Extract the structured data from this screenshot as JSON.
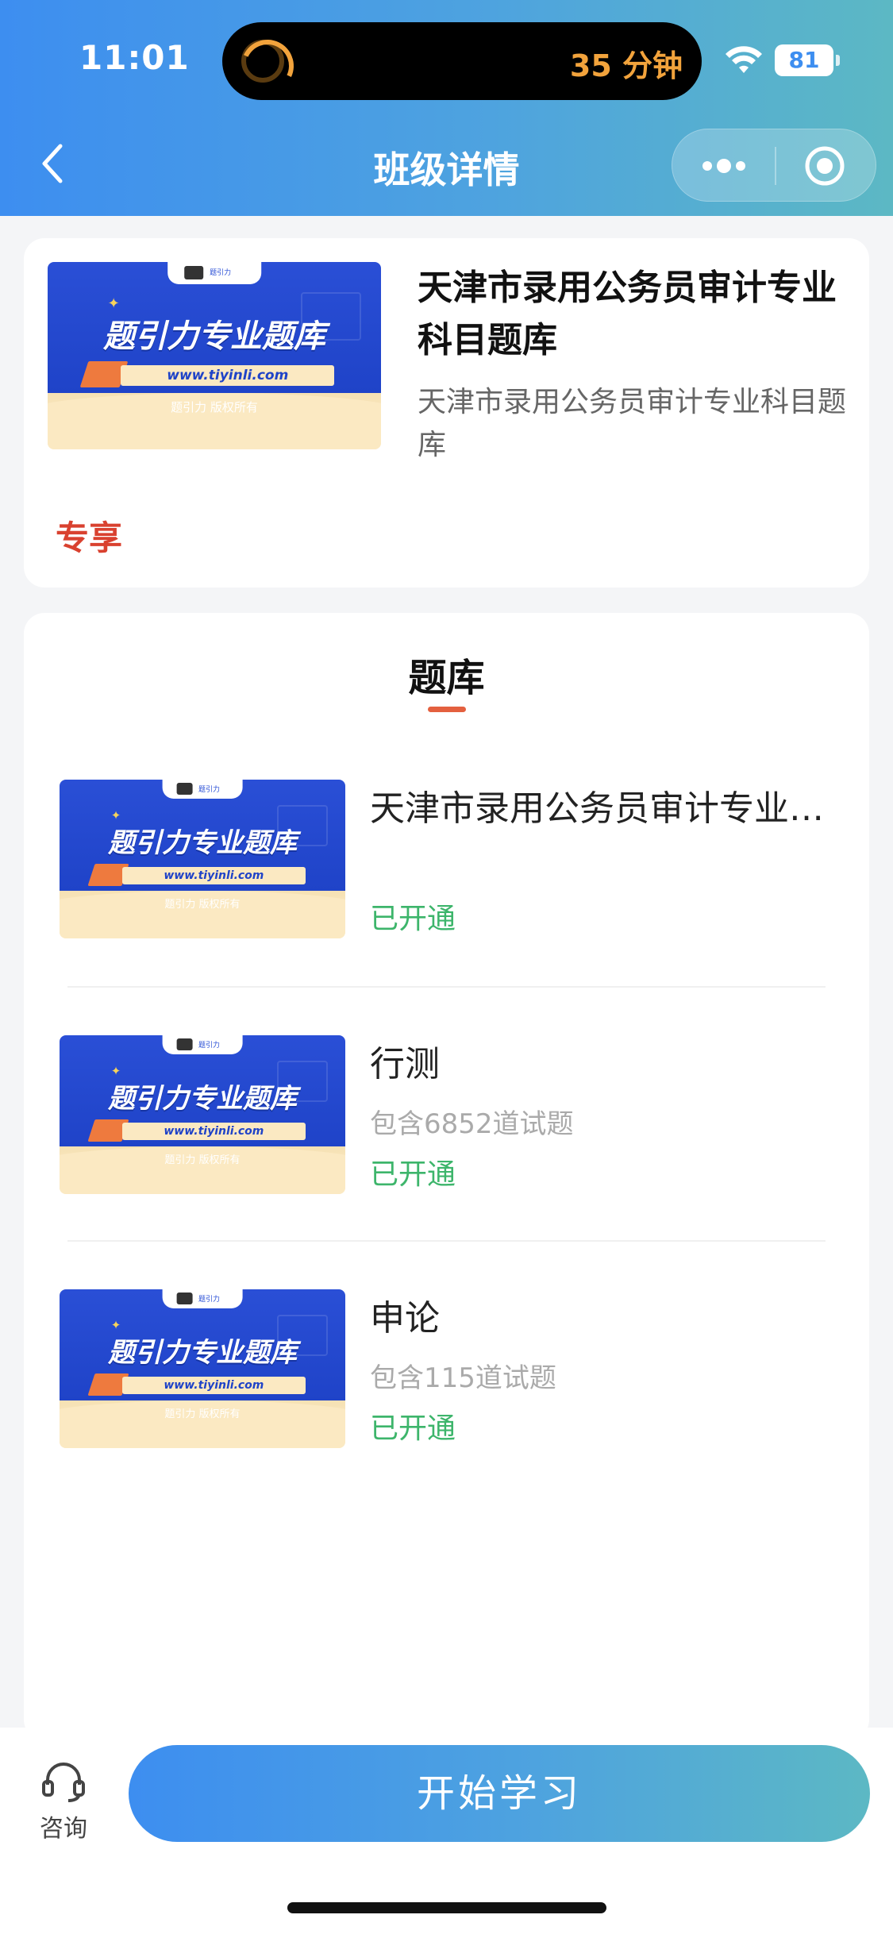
{
  "status": {
    "time": "11:01",
    "timer_text": "35 分钟",
    "battery": "81"
  },
  "nav": {
    "title": "班级详情"
  },
  "banner": {
    "badge": "题引力",
    "headline": "题引力专业题库",
    "url": "www.tiyinli.com",
    "copyright": "题引力 版权所有"
  },
  "class_info": {
    "title": "天津市录用公务员审计专业科目题库",
    "description": "天津市录用公务员审计专业科目题库",
    "tag": "专享"
  },
  "bank_section": {
    "title": "题库",
    "items": [
      {
        "name": "天津市录用公务员审计专业科目题库",
        "count": "",
        "status": "已开通"
      },
      {
        "name": "行测",
        "count": "包含6852道试题",
        "status": "已开通"
      },
      {
        "name": "申论",
        "count": "包含115道试题",
        "status": "已开通"
      }
    ]
  },
  "bottom": {
    "consult_label": "咨询",
    "start_label": "开始学习"
  },
  "colors": {
    "accent": "#3d8ef0",
    "success": "#3db56b",
    "tag": "#d9412f"
  }
}
